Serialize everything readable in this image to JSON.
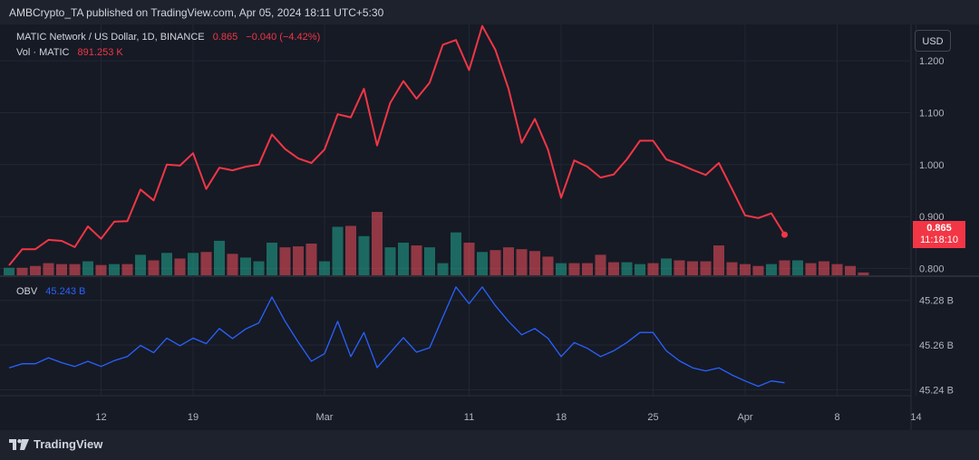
{
  "header": {
    "published": "AMBCrypto_TA published on TradingView.com, Apr 05, 2024 18:11 UTC+5:30"
  },
  "legend": {
    "symbol": "MATIC Network / US Dollar, 1D, BINANCE",
    "price": "0.865",
    "change": "−0.040 (−4.42%)",
    "vol_label": "Vol · MATIC",
    "vol_value": "891.253 K",
    "obv_label": "OBV",
    "obv_value": "45.243 B"
  },
  "currency_button": "USD",
  "price_tag": {
    "price": "0.865",
    "countdown": "11:18:10"
  },
  "footer": {
    "brand": "TradingView"
  },
  "colors": {
    "price_line": "#f23645",
    "obv_line": "#2962ff",
    "vol_up": "#22ab94",
    "vol_down": "#f7525f",
    "background": "#161a25"
  },
  "chart_data": [
    {
      "type": "line",
      "name": "price",
      "y_ticks": [
        "1.200",
        "1.100",
        "1.000",
        "0.900",
        "0.800"
      ],
      "ylim": [
        0.785,
        1.27
      ],
      "x_ticks": [
        {
          "day": 12,
          "label": "12"
        },
        {
          "day": 19,
          "label": "19"
        },
        {
          "day": 29,
          "label": "Mar"
        },
        {
          "day": 40,
          "label": "11"
        },
        {
          "day": 47,
          "label": "18"
        },
        {
          "day": 54,
          "label": "25"
        },
        {
          "day": 61,
          "label": "Apr"
        },
        {
          "day": 68,
          "label": "8"
        },
        {
          "day": 74,
          "label": "14"
        }
      ],
      "x_days_start": 5,
      "values": [
        0.806,
        0.837,
        0.837,
        0.855,
        0.853,
        0.841,
        0.881,
        0.857,
        0.89,
        0.891,
        0.952,
        0.931,
        1.0,
        0.998,
        1.022,
        0.953,
        0.994,
        0.989,
        0.996,
        1.0,
        1.058,
        1.03,
        1.012,
        1.003,
        1.029,
        1.097,
        1.091,
        1.146,
        1.037,
        1.119,
        1.161,
        1.127,
        1.158,
        1.231,
        1.24,
        1.182,
        1.267,
        1.221,
        1.146,
        1.042,
        1.088,
        1.029,
        0.936,
        1.008,
        0.996,
        0.975,
        0.981,
        1.01,
        1.046,
        1.046,
        1.01,
        1.001,
        0.99,
        0.98,
        1.003,
        0.953,
        0.902,
        0.897,
        0.906,
        0.865
      ]
    },
    {
      "type": "bar",
      "name": "volume",
      "values": [
        8,
        8,
        10,
        13,
        12,
        12,
        15,
        11,
        12,
        12,
        22,
        16,
        24,
        18,
        24,
        25,
        37,
        23,
        19,
        15,
        35,
        30,
        31,
        34,
        15,
        52,
        53,
        42,
        68,
        30,
        35,
        32,
        30,
        13,
        46,
        35,
        25,
        27,
        30,
        28,
        26,
        20,
        13,
        13,
        13,
        22,
        14,
        14,
        12,
        13,
        18,
        16,
        15,
        15,
        32,
        14,
        12,
        10,
        12,
        16,
        16,
        13,
        15,
        12,
        10,
        3
      ],
      "up": [
        true,
        false,
        false,
        false,
        false,
        false,
        true,
        false,
        true,
        false,
        true,
        false,
        true,
        false,
        true,
        false,
        true,
        false,
        true,
        true,
        true,
        false,
        false,
        false,
        true,
        true,
        false,
        true,
        false,
        true,
        true,
        false,
        true,
        true,
        true,
        false,
        true,
        false,
        false,
        false,
        false,
        false,
        true,
        false,
        false,
        false,
        false,
        true,
        true,
        false,
        true,
        false,
        false,
        false,
        false,
        false,
        false,
        false,
        true,
        false,
        true,
        false,
        false,
        false,
        false,
        false
      ]
    },
    {
      "type": "line",
      "name": "obv",
      "y_ticks": [
        "45.28 B",
        "45.26 B",
        "45.24 B"
      ],
      "ylim": [
        45.2373,
        45.2892
      ],
      "values": [
        45.2498,
        45.2516,
        45.2516,
        45.2543,
        45.2521,
        45.2504,
        45.2527,
        45.2504,
        45.253,
        45.2548,
        45.2598,
        45.2566,
        45.2631,
        45.2597,
        45.2631,
        45.2606,
        45.2674,
        45.2629,
        45.2672,
        45.2699,
        45.2815,
        45.2706,
        45.2613,
        45.2527,
        45.2561,
        45.2706,
        45.2548,
        45.2656,
        45.2499,
        45.2566,
        45.2633,
        45.2568,
        45.2588,
        45.2725,
        45.286,
        45.2785,
        45.286,
        45.2776,
        45.2706,
        45.2646,
        45.2674,
        45.263,
        45.2548,
        45.2611,
        45.2585,
        45.2548,
        45.2574,
        45.2611,
        45.2656,
        45.2656,
        45.2574,
        45.2529,
        45.2498,
        45.2484,
        45.2498,
        45.2466,
        45.2439,
        45.2415,
        45.2439,
        45.2431
      ]
    }
  ]
}
